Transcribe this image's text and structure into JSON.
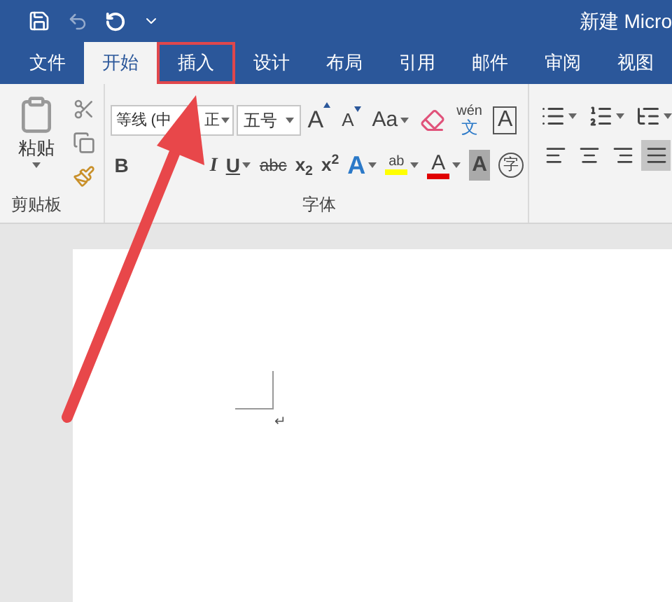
{
  "window": {
    "title": "新建 Micro"
  },
  "tabs": [
    {
      "label": "文件",
      "selected": false,
      "annotated": false
    },
    {
      "label": "开始",
      "selected": true,
      "annotated": false
    },
    {
      "label": "插入",
      "selected": false,
      "annotated": true
    },
    {
      "label": "设计",
      "selected": false,
      "annotated": false
    },
    {
      "label": "布局",
      "selected": false,
      "annotated": false
    },
    {
      "label": "引用",
      "selected": false,
      "annotated": false
    },
    {
      "label": "邮件",
      "selected": false,
      "annotated": false
    },
    {
      "label": "审阅",
      "selected": false,
      "annotated": false
    },
    {
      "label": "视图",
      "selected": false,
      "annotated": false
    }
  ],
  "clipboard": {
    "paste_label": "粘贴",
    "group_label": "剪贴板"
  },
  "font": {
    "font_name_parts": [
      "等线 (中",
      "正"
    ],
    "font_size": "五号",
    "group_label": "字体",
    "row1": [
      {
        "kind": "grow",
        "label": "A"
      },
      {
        "kind": "shrink",
        "label": "A"
      },
      {
        "kind": "case",
        "label": "Aa"
      },
      {
        "kind": "clear"
      },
      {
        "kind": "phonetic",
        "label": "wén",
        "sub": "文"
      },
      {
        "kind": "border",
        "label": "A"
      }
    ],
    "row2": [
      {
        "kind": "bold",
        "label": "B"
      },
      {
        "kind": "italic",
        "label": "I"
      },
      {
        "kind": "underline",
        "label": "U"
      },
      {
        "kind": "strike",
        "label": "abc"
      },
      {
        "kind": "subscript",
        "label": "x$_{2}$"
      },
      {
        "kind": "superscript",
        "label": "x$^{2}$"
      },
      {
        "kind": "effects",
        "label": "A"
      },
      {
        "kind": "highlight",
        "label": "ab"
      },
      {
        "kind": "color",
        "label": "A"
      },
      {
        "kind": "shade",
        "label": "A"
      },
      {
        "kind": "enclose",
        "label": "字"
      }
    ]
  },
  "paragraph": {
    "lists": [
      {
        "kind": "bullets"
      },
      {
        "kind": "numbers"
      },
      {
        "kind": "multilevel"
      }
    ],
    "align": [
      {
        "kind": "left",
        "selected": false
      },
      {
        "kind": "center",
        "selected": false
      },
      {
        "kind": "right",
        "selected": false
      },
      {
        "kind": "justify",
        "selected": true
      }
    ]
  },
  "document": {
    "paragraph_mark": "↵"
  }
}
